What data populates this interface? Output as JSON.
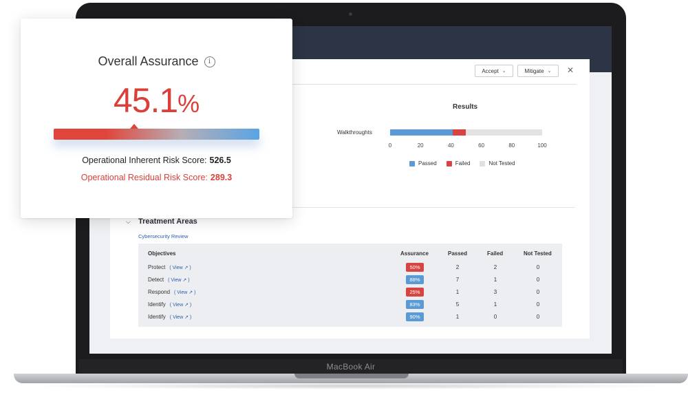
{
  "device": {
    "label": "MacBook Air"
  },
  "panel": {
    "actions": {
      "accept": "Accept",
      "mitigate": "Mitigate"
    },
    "results": {
      "title": "Results",
      "bar_label": "Walkthroughts",
      "ticks": [
        "0",
        "20",
        "40",
        "60",
        "80",
        "100"
      ],
      "segments": {
        "passed": 41,
        "failed": 9,
        "not_tested": 50
      },
      "legend": {
        "passed": "Passed",
        "failed": "Failed",
        "not_tested": "Not Tested"
      },
      "colors": {
        "passed": "#5b9bd5",
        "failed": "#d64541",
        "not_tested": "#e3e3e3"
      }
    },
    "treatment": {
      "title": "Treatment Areas",
      "link": "Cybersecurity Review",
      "headers": {
        "objectives": "Objectives",
        "assurance": "Assurance",
        "passed": "Passed",
        "failed": "Failed",
        "not_tested": "Not Tested"
      },
      "view_label": "( View ↗ )",
      "rows": [
        {
          "objective": "Protect",
          "assurance": "50%",
          "status": "red",
          "passed": "2",
          "failed": "2",
          "not_tested": "0"
        },
        {
          "objective": "Detect",
          "assurance": "88%",
          "status": "blue",
          "passed": "7",
          "failed": "1",
          "not_tested": "0"
        },
        {
          "objective": "Respond",
          "assurance": "25%",
          "status": "red",
          "passed": "1",
          "failed": "3",
          "not_tested": "0"
        },
        {
          "objective": "Identify",
          "assurance": "83%",
          "status": "blue",
          "passed": "5",
          "failed": "1",
          "not_tested": "0"
        },
        {
          "objective": "Identify",
          "assurance": "90%",
          "status": "blue",
          "passed": "1",
          "failed": "0",
          "not_tested": "0"
        }
      ]
    }
  },
  "card": {
    "title": "Overall Assurance",
    "info_icon": "info-circle-icon",
    "value": "45.1",
    "unit": "%",
    "marker_level": 0.39,
    "inherent_label": "Operational Inherent Risk Score:",
    "inherent_value": "526.5",
    "residual_label": "Operational Residual Risk Score:",
    "residual_value": "289.3",
    "colors": {
      "accent_red": "#d9403a",
      "accent_blue": "#5aa4e4"
    }
  }
}
